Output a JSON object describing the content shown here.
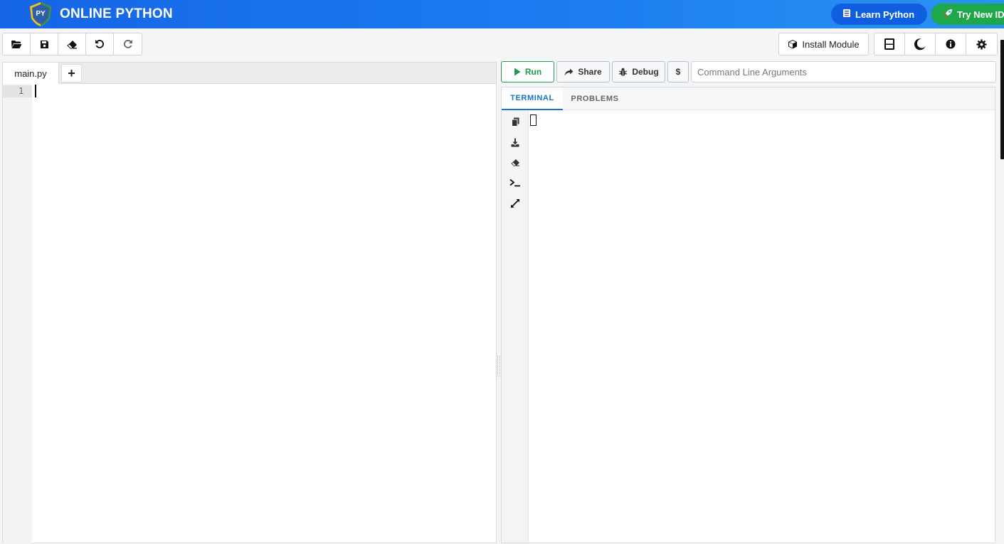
{
  "header": {
    "brand": "ONLINE PYTHON",
    "logo_text": "PY",
    "learn_label": "Learn Python",
    "try_label": "Try New IDE"
  },
  "toolbar": {
    "left_icons": [
      "folder-open-icon",
      "save-icon",
      "eraser-icon",
      "undo-icon",
      "redo-icon"
    ],
    "install_label": "Install Module",
    "right_icons": [
      "layout-icon",
      "moon-icon",
      "info-icon",
      "gear-icon"
    ]
  },
  "editor": {
    "file_tab": "main.py",
    "add_tab": "+",
    "line_numbers": [
      "1"
    ]
  },
  "runbar": {
    "run_label": "Run",
    "share_label": "Share",
    "debug_label": "Debug",
    "dollar_label": "$",
    "args_placeholder": "Command Line Arguments"
  },
  "terminal": {
    "tabs": [
      "TERMINAL",
      "PROBLEMS"
    ],
    "active_tab": "TERMINAL",
    "side_icons": [
      "copy-icon",
      "download-icon",
      "eraser-icon",
      "prompt-icon",
      "expand-icon"
    ]
  },
  "colors": {
    "banner": "#1b7cf0",
    "learn_button": "#0f5fe0",
    "try_button": "#1ea84a",
    "run_green": "#1f9a4a",
    "active_tab_blue": "#1a73c9"
  }
}
